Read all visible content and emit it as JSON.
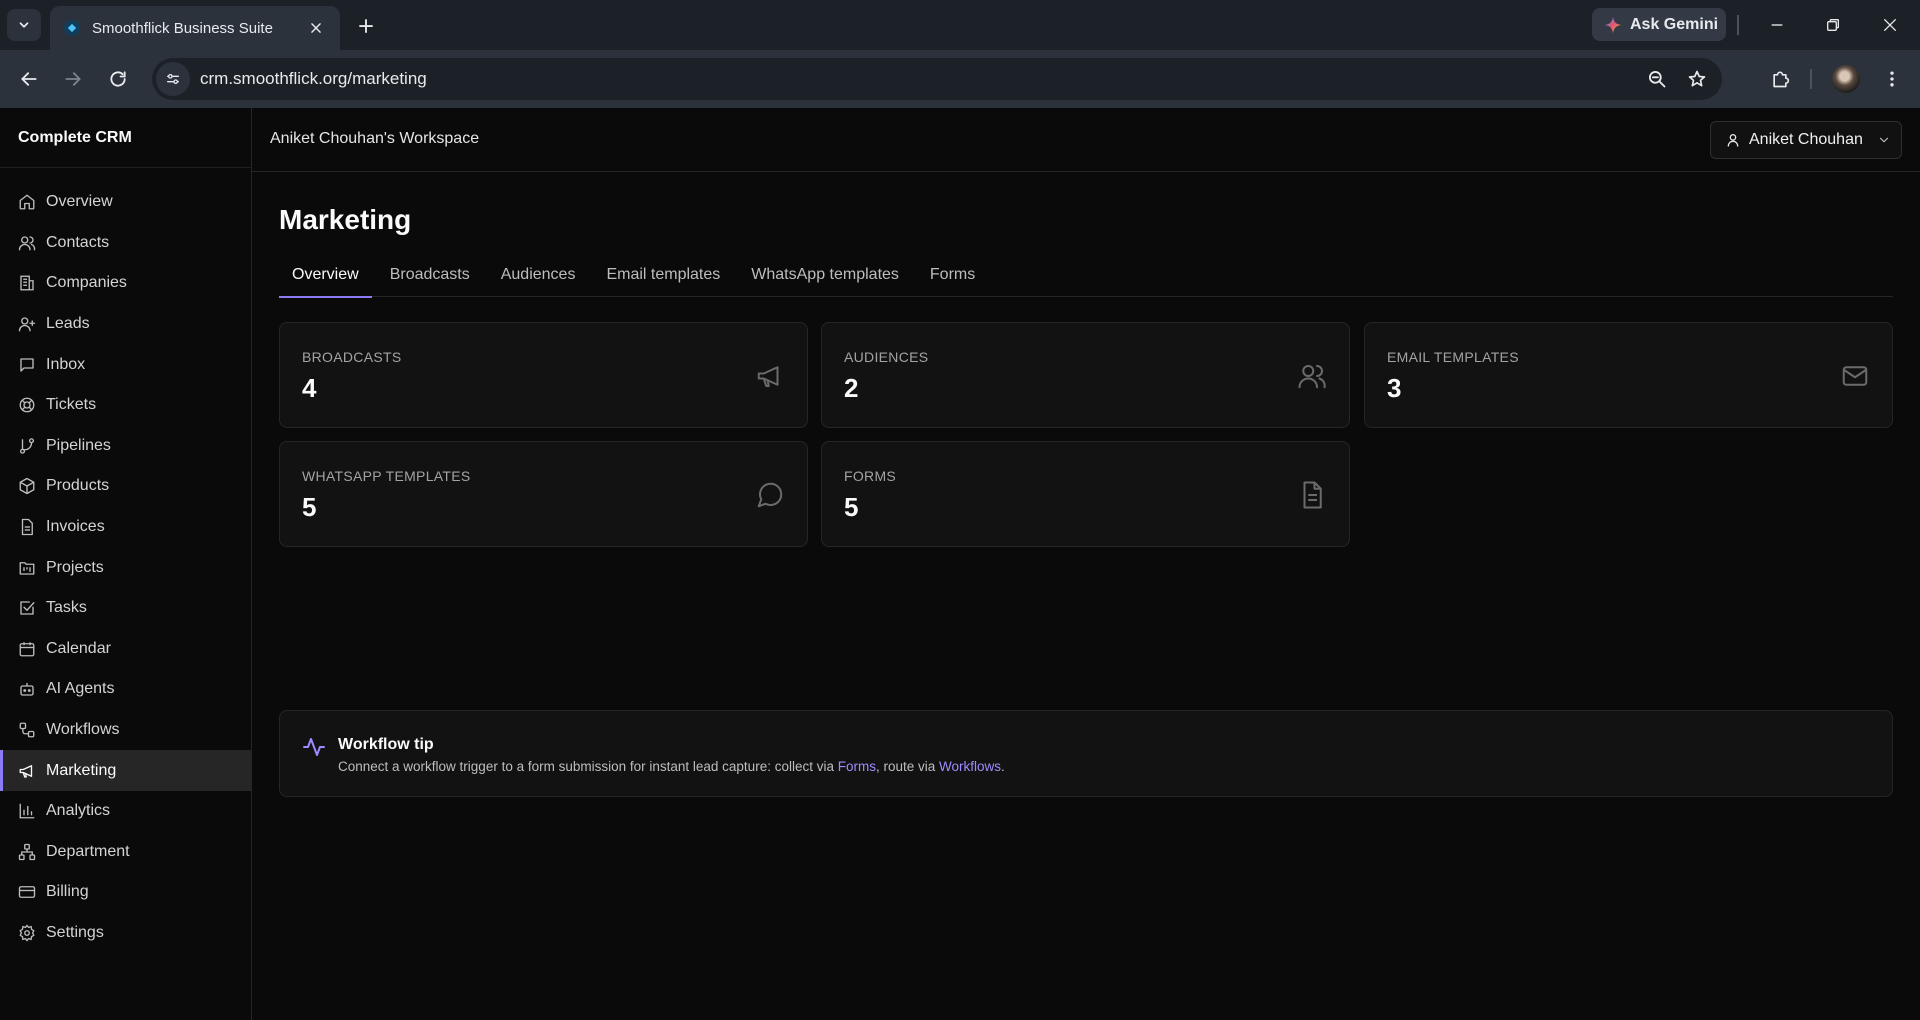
{
  "browser": {
    "tab_title": "Smoothflick Business Suite",
    "url": "crm.smoothflick.org/marketing",
    "gemini_label": "Ask Gemini"
  },
  "sidebar": {
    "brand": "Complete CRM",
    "items": [
      {
        "label": "Overview",
        "icon": "home-icon"
      },
      {
        "label": "Contacts",
        "icon": "users-icon"
      },
      {
        "label": "Companies",
        "icon": "building-icon"
      },
      {
        "label": "Leads",
        "icon": "user-plus-icon"
      },
      {
        "label": "Inbox",
        "icon": "message-square-icon"
      },
      {
        "label": "Tickets",
        "icon": "life-buoy-icon"
      },
      {
        "label": "Pipelines",
        "icon": "git-branch-icon"
      },
      {
        "label": "Products",
        "icon": "package-icon"
      },
      {
        "label": "Invoices",
        "icon": "file-text-icon"
      },
      {
        "label": "Projects",
        "icon": "folder-kanban-icon"
      },
      {
        "label": "Tasks",
        "icon": "check-square-icon"
      },
      {
        "label": "Calendar",
        "icon": "calendar-icon"
      },
      {
        "label": "AI Agents",
        "icon": "bot-icon"
      },
      {
        "label": "Workflows",
        "icon": "workflow-icon"
      },
      {
        "label": "Marketing",
        "icon": "megaphone-icon",
        "active": true
      },
      {
        "label": "Analytics",
        "icon": "bar-chart-icon"
      },
      {
        "label": "Department",
        "icon": "network-icon"
      },
      {
        "label": "Billing",
        "icon": "credit-card-icon"
      },
      {
        "label": "Settings",
        "icon": "gear-icon"
      }
    ]
  },
  "header": {
    "workspace": "Aniket Chouhan's Workspace",
    "user_name": "Aniket Chouhan"
  },
  "main": {
    "title": "Marketing",
    "tabs": [
      "Overview",
      "Broadcasts",
      "Audiences",
      "Email templates",
      "WhatsApp templates",
      "Forms"
    ],
    "active_tab": "Overview",
    "cards": [
      {
        "label": "BROADCASTS",
        "value": "4",
        "icon": "megaphone-icon"
      },
      {
        "label": "AUDIENCES",
        "value": "2",
        "icon": "users-icon"
      },
      {
        "label": "EMAIL TEMPLATES",
        "value": "3",
        "icon": "mail-icon"
      },
      {
        "label": "WHATSAPP TEMPLATES",
        "value": "5",
        "icon": "message-circle-icon"
      },
      {
        "label": "FORMS",
        "value": "5",
        "icon": "file-text-icon"
      }
    ],
    "tip": {
      "title": "Workflow tip",
      "text_before": "Connect a workflow trigger to a form submission for instant lead capture: collect via ",
      "link1": "Forms",
      "text_middle": ", route via ",
      "link2": "Workflows",
      "text_after": "."
    }
  },
  "colors": {
    "accent": "#8b7cf6",
    "link": "#9d8cff",
    "background": "#0a0a0a",
    "card": "#121212"
  }
}
